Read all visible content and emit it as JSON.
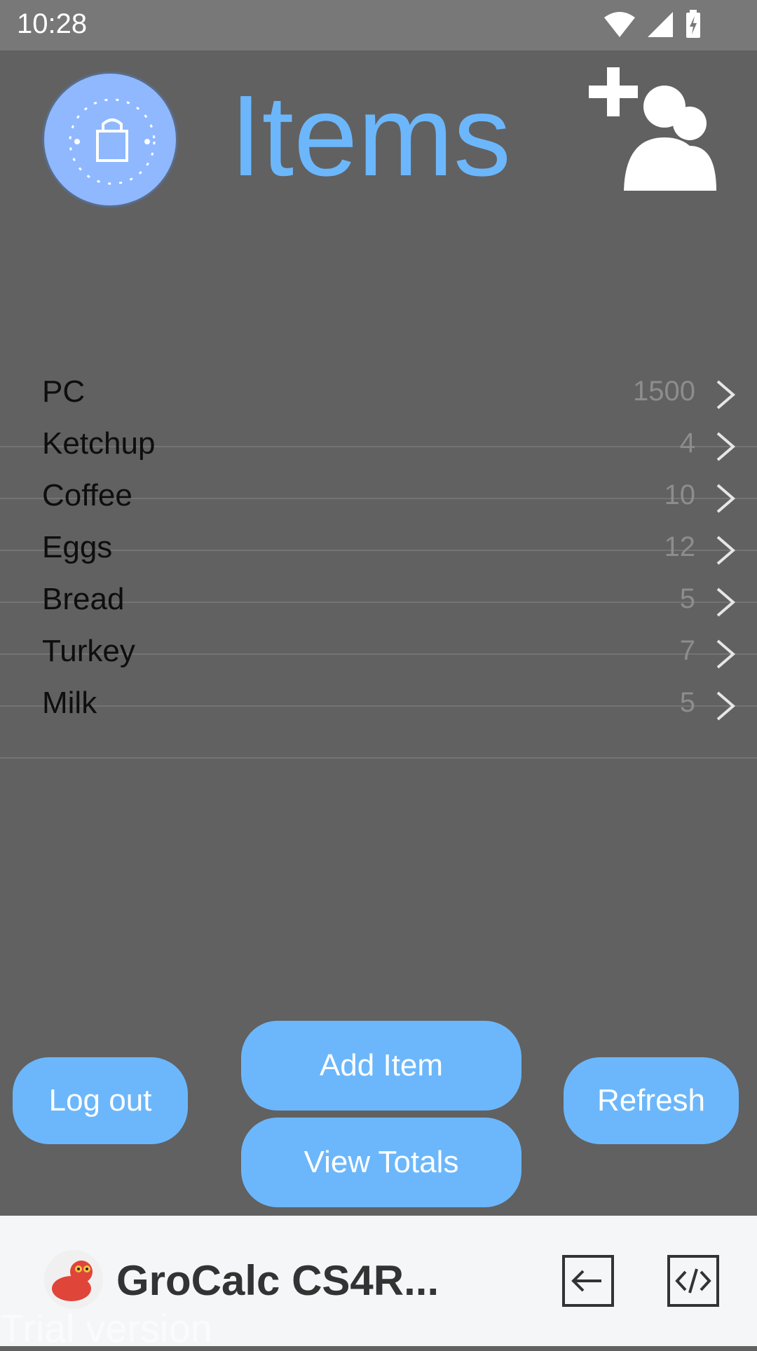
{
  "status_bar": {
    "time": "10:28"
  },
  "header": {
    "title": "Items"
  },
  "items": [
    {
      "name": "PC",
      "qty": "1500"
    },
    {
      "name": "Ketchup",
      "qty": "4"
    },
    {
      "name": "Coffee",
      "qty": "10"
    },
    {
      "name": "Eggs",
      "qty": "12"
    },
    {
      "name": "Bread",
      "qty": "5"
    },
    {
      "name": "Turkey",
      "qty": "7"
    },
    {
      "name": "Milk",
      "qty": "5"
    }
  ],
  "buttons": {
    "add_item": "Add Item",
    "view_totals": "View Totals",
    "log_out": "Log out",
    "refresh": "Refresh"
  },
  "banner": {
    "app_name": "GroCalc CS4R...",
    "trial_text": "Trial version"
  },
  "colors": {
    "accent": "#6cb7fb",
    "background": "#616161",
    "logo_bg": "#8fb8ff"
  },
  "icons": [
    "wifi-icon",
    "signal-icon",
    "battery-icon",
    "add-user-icon",
    "chevron-right-icon",
    "exit-icon",
    "code-icon"
  ]
}
